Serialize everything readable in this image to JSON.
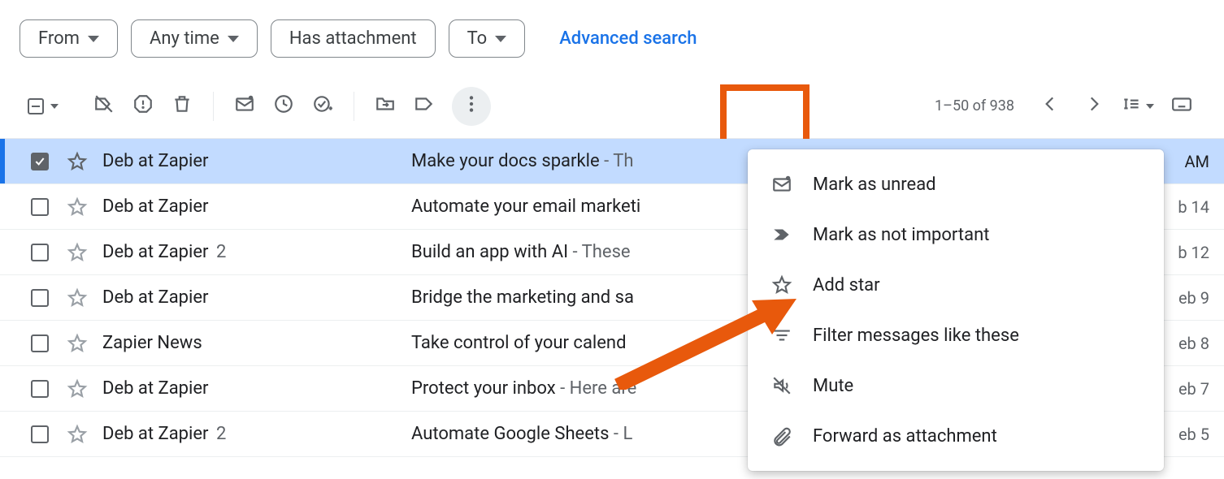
{
  "filters": {
    "from": "From",
    "anytime": "Any time",
    "has_attachment": "Has attachment",
    "to": "To",
    "advanced": "Advanced search"
  },
  "pagination": "1–50 of 938",
  "menu": {
    "mark_unread": "Mark as unread",
    "mark_not_important": "Mark as not important",
    "add_star": "Add star",
    "filter_like": "Filter messages like these",
    "mute": "Mute",
    "forward_attachment": "Forward as attachment"
  },
  "emails": [
    {
      "sender": "Deb at Zapier",
      "count": "",
      "subject": "Make your docs sparkle",
      "snippet": " - Th",
      "date": "AM",
      "selected": true
    },
    {
      "sender": "Deb at Zapier",
      "count": "",
      "subject": "Automate your email marketi",
      "snippet": "",
      "date": "b 14",
      "selected": false
    },
    {
      "sender": "Deb at Zapier",
      "count": "2",
      "subject": "Build an app with AI",
      "snippet": " - These",
      "date": "b 12",
      "selected": false
    },
    {
      "sender": "Deb at Zapier",
      "count": "",
      "subject": "Bridge the marketing and sa",
      "snippet": "",
      "date": "eb 9",
      "selected": false
    },
    {
      "sender": "Zapier News",
      "count": "",
      "subject": "Take control of your calend",
      "snippet": "",
      "date": "eb 8",
      "selected": false
    },
    {
      "sender": "Deb at Zapier",
      "count": "",
      "subject": "Protect your inbox",
      "snippet": " - Here are",
      "date": "eb 7",
      "selected": false
    },
    {
      "sender": "Deb at Zapier",
      "count": "2",
      "subject": "Automate Google Sheets",
      "snippet": " - L",
      "date": "eb 5",
      "selected": false
    }
  ]
}
